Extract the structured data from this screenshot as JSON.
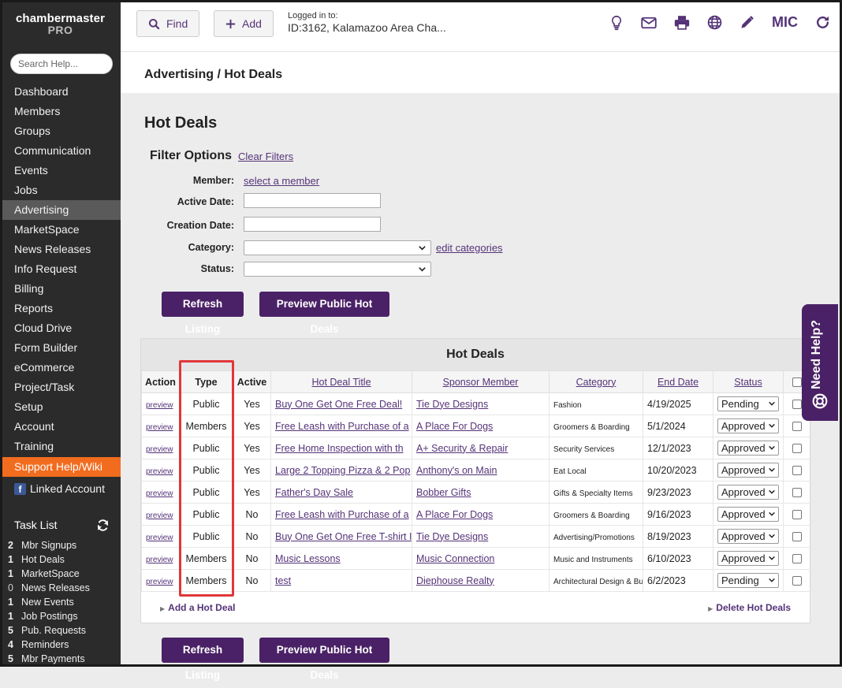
{
  "sidebar": {
    "logo_line1": "chambermaster",
    "logo_line2": "PRO",
    "search_placeholder": "Search Help...",
    "nav": [
      "Dashboard",
      "Members",
      "Groups",
      "Communication",
      "Events",
      "Jobs",
      "Advertising",
      "MarketSpace",
      "News Releases",
      "Info Request",
      "Billing",
      "Reports",
      "Cloud Drive",
      "Form Builder",
      "eCommerce",
      "Project/Task",
      "Setup",
      "Account",
      "Training"
    ],
    "active_item": "Advertising",
    "support": "Support Help/Wiki",
    "linked": "Linked Account",
    "task_title": "Task List",
    "tasks": [
      {
        "count": "2",
        "label": "Mbr Signups"
      },
      {
        "count": "1",
        "label": "Hot Deals"
      },
      {
        "count": "1",
        "label": "MarketSpace"
      },
      {
        "count": "0",
        "label": "News Releases"
      },
      {
        "count": "1",
        "label": "New Events"
      },
      {
        "count": "1",
        "label": "Job Postings"
      },
      {
        "count": "5",
        "label": "Pub. Requests"
      },
      {
        "count": "4",
        "label": "Reminders"
      },
      {
        "count": "5",
        "label": "Mbr Payments"
      }
    ]
  },
  "topbar": {
    "find_label": "Find",
    "add_label": "Add",
    "logged_in_label": "Logged in to:",
    "logged_in_value": "ID:3162, Kalamazoo Area Cha...",
    "user_initials": "MIC"
  },
  "breadcrumb": "Advertising / Hot Deals",
  "page": {
    "title": "Hot Deals",
    "filter_title": "Filter Options",
    "clear_filters": "Clear Filters",
    "member_label": "Member:",
    "member_link": "select a member",
    "active_date_label": "Active Date:",
    "creation_date_label": "Creation Date:",
    "category_label": "Category:",
    "edit_categories": "edit categories",
    "status_label": "Status:",
    "refresh_label": "Refresh Listing",
    "preview_label": "Preview Public Hot Deals"
  },
  "table": {
    "title": "Hot Deals",
    "headers": {
      "action": "Action",
      "type": "Type",
      "active": "Active",
      "title": "Hot Deal Title",
      "sponsor": "Sponsor Member",
      "category": "Category",
      "end_date": "End Date",
      "status": "Status"
    },
    "rows": [
      {
        "action": "preview",
        "type": "Public",
        "active": "Yes",
        "title": "Buy One Get One Free Deal!",
        "sponsor": "Tie Dye Designs",
        "category": "Fashion",
        "end": "4/19/2025",
        "status": "Pending"
      },
      {
        "action": "preview",
        "type": "Members",
        "active": "Yes",
        "title": "Free Leash with Purchase of a",
        "sponsor": "A Place For Dogs",
        "category": "Groomers & Boarding",
        "end": "5/1/2024",
        "status": "Approved"
      },
      {
        "action": "preview",
        "type": "Public",
        "active": "Yes",
        "title": "Free Home Inspection with th",
        "sponsor": "A+ Security & Repair",
        "category": "Security Services",
        "end": "12/1/2023",
        "status": "Approved"
      },
      {
        "action": "preview",
        "type": "Public",
        "active": "Yes",
        "title": "Large 2 Topping Pizza & 2 Pop",
        "sponsor": "Anthony's on Main",
        "category": "Eat Local",
        "end": "10/20/2023",
        "status": "Approved"
      },
      {
        "action": "preview",
        "type": "Public",
        "active": "Yes",
        "title": "Father's Day Sale",
        "sponsor": "Bobber Gifts",
        "category": "Gifts & Specialty Items",
        "end": "9/23/2023",
        "status": "Approved"
      },
      {
        "action": "preview",
        "type": "Public",
        "active": "No",
        "title": "Free Leash with Purchase of a",
        "sponsor": "A Place For Dogs",
        "category": "Groomers & Boarding",
        "end": "9/16/2023",
        "status": "Approved"
      },
      {
        "action": "preview",
        "type": "Public",
        "active": "No",
        "title": "Buy One Get One Free T-shirt I",
        "sponsor": "Tie Dye Designs",
        "category": "Advertising/Promotions",
        "end": "8/19/2023",
        "status": "Approved"
      },
      {
        "action": "preview",
        "type": "Members",
        "active": "No",
        "title": "Music Lessons",
        "sponsor": "Music Connection",
        "category": "Music and Instruments",
        "end": "6/10/2023",
        "status": "Approved"
      },
      {
        "action": "preview",
        "type": "Members",
        "active": "No",
        "title": "test",
        "sponsor": "Diephouse Realty",
        "category": "Architectural Design & Bu",
        "end": "6/2/2023",
        "status": "Pending"
      }
    ],
    "add_link": "Add a Hot Deal",
    "delete_link": "Delete Hot Deals"
  },
  "need_help": "Need Help?",
  "colors": {
    "brand": "#4a2166",
    "accent": "#553378",
    "support": "#f26c1f",
    "highlight": "#e0373a"
  }
}
